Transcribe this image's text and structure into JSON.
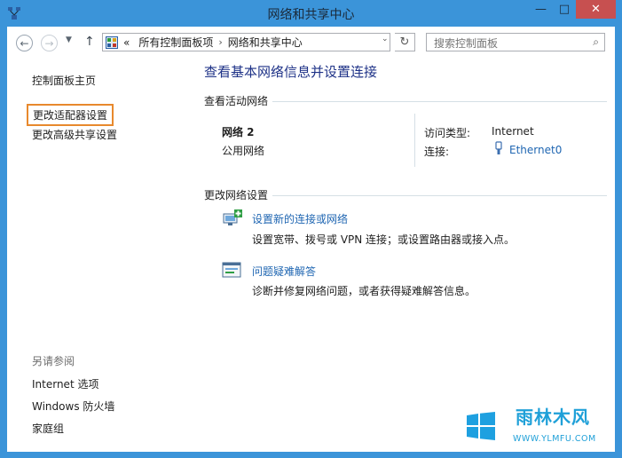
{
  "window": {
    "title": "网络和共享中心",
    "controls": {
      "minimize": "—",
      "maximize": "□",
      "close": "✕"
    }
  },
  "nav": {
    "back_icon": "←",
    "forward_icon": "→",
    "recent_icon": "▼",
    "up_icon": "↑"
  },
  "address": {
    "overflow": "«",
    "crumbs": [
      "所有控制面板项",
      "网络和共享中心"
    ],
    "separator": "›",
    "dropdown": "⌄",
    "refresh": "↻"
  },
  "search": {
    "placeholder": "搜索控制面板",
    "icon": "⌕"
  },
  "sidebar": {
    "home": "控制面板主页",
    "adapter": "更改适配器设置",
    "sharing": "更改高级共享设置",
    "see_also": "另请参阅",
    "links": [
      "Internet 选项",
      "Windows 防火墙",
      "家庭组"
    ]
  },
  "main": {
    "title": "查看基本网络信息并设置连接",
    "active_header": "查看活动网络",
    "network": {
      "name": "网络  2",
      "profile": "公用网络",
      "access_label": "访问类型:",
      "access_value": "Internet",
      "conn_label": "连接:",
      "conn_value": "Ethernet0"
    },
    "change_header": "更改网络设置",
    "tasks": [
      {
        "link": "设置新的连接或网络",
        "desc": "设置宽带、拨号或 VPN 连接；或设置路由器或接入点。"
      },
      {
        "link": "问题疑难解答",
        "desc": "诊断并修复网络问题，或者获得疑难解答信息。"
      }
    ]
  },
  "watermark": {
    "text": "雨林木风",
    "url": "WWW.YLMFU.COM"
  },
  "colors": {
    "frame": "#3b94d9",
    "link": "#1f66b2",
    "title": "#1e3287",
    "highlight": "#e8892d",
    "close": "#c75050"
  }
}
